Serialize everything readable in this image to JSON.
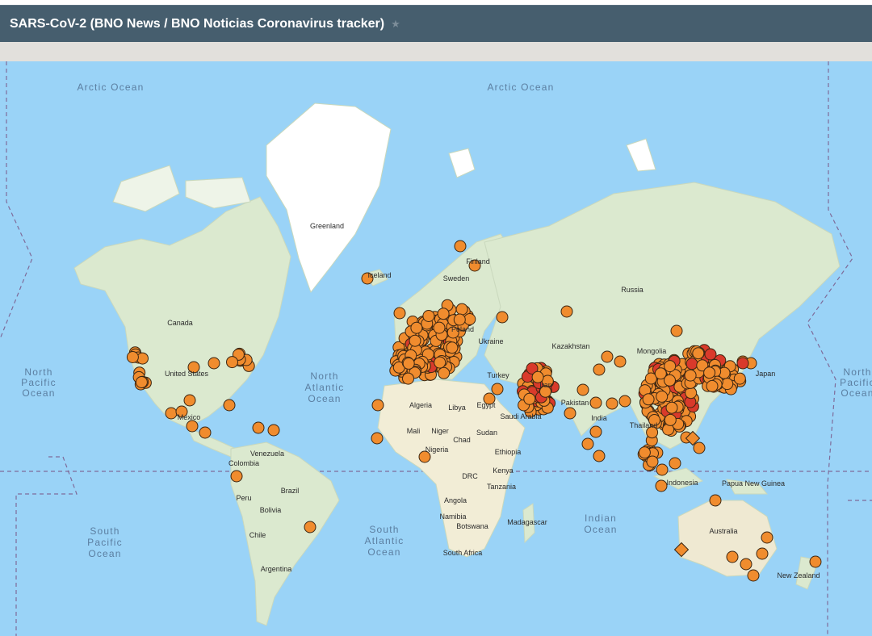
{
  "header": {
    "title": "SARS-CoV-2 (BNO News / BNO Noticias Coronavirus tracker)",
    "star_icon": "star-icon"
  },
  "map": {
    "colors": {
      "ocean": "#9ad3f7",
      "land": "#e7f1dc",
      "forest": "#cfe6c3",
      "desert": "#f4efd9",
      "ice": "#ffffff",
      "marker": "#f08c2e",
      "marker_severe": "#d93a2b",
      "marker_stroke": "#3b2612"
    },
    "labels": {
      "oceans": [
        {
          "id": "arctic-1",
          "lines": [
            "Arctic Ocean"
          ]
        },
        {
          "id": "arctic-2",
          "lines": [
            "Arctic Ocean"
          ]
        },
        {
          "id": "north-pacific-left",
          "lines": [
            "North",
            "Pacific",
            "Ocean"
          ]
        },
        {
          "id": "north-pacific-right",
          "lines": [
            "North",
            "Pacific",
            "Ocean"
          ]
        },
        {
          "id": "north-atlantic",
          "lines": [
            "North",
            "Atlantic",
            "Ocean"
          ]
        },
        {
          "id": "south-pacific",
          "lines": [
            "South",
            "Pacific",
            "Ocean"
          ]
        },
        {
          "id": "south-atlantic",
          "lines": [
            "South",
            "Atlantic",
            "Ocean"
          ]
        },
        {
          "id": "indian",
          "lines": [
            "Indian",
            "Ocean"
          ]
        }
      ],
      "countries": [
        "Greenland",
        "Iceland",
        "Sweden",
        "Finland",
        "Russia",
        "Canada",
        "United States",
        "Mexico",
        "Ukraine",
        "Poland",
        "Kazakhstan",
        "Mongolia",
        "Turkey",
        "Algeria",
        "Libya",
        "Egypt",
        "Mali",
        "Niger",
        "Chad",
        "Sudan",
        "Nigeria",
        "Ethiopia",
        "Kenya",
        "DRC",
        "Tanzania",
        "Angola",
        "Namibia",
        "Botswana",
        "South Africa",
        "Madagascar",
        "Saudi Arabia",
        "Iran",
        "Pakistan",
        "India",
        "Indonesia",
        "Papua New Guinea",
        "Australia",
        "New Zealand",
        "Venezuela",
        "Colombia",
        "Peru",
        "Brazil",
        "Bolivia",
        "Chile",
        "Argentina",
        "Japan",
        "Thailand"
      ]
    }
  }
}
